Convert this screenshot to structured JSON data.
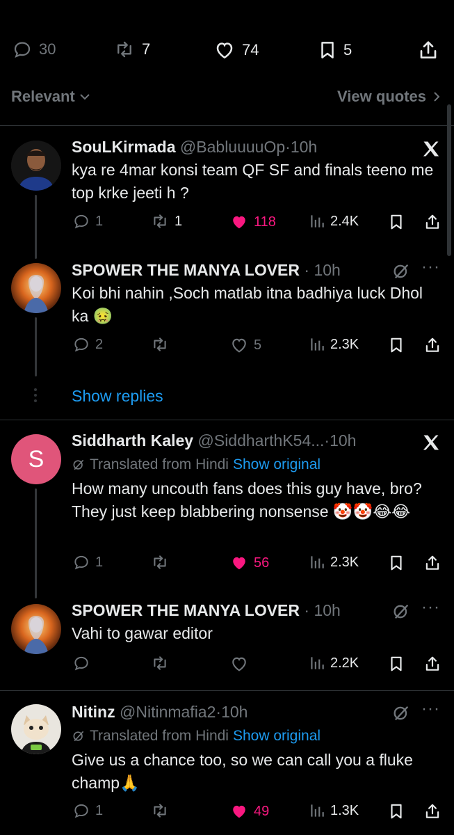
{
  "top_stats": {
    "replies": "30",
    "reposts": "7",
    "likes": "74",
    "bookmarks": "5"
  },
  "filter": {
    "label": "Relevant",
    "view_quotes": "View quotes"
  },
  "replies": [
    {
      "name": "SouLKirmada",
      "handle": "@BabluuuuOp",
      "time": "10h",
      "text": "kya re 4mar konsi team QF SF and finals teeno me top krke jeeti h ?",
      "stats": {
        "replies": "1",
        "reposts": "1",
        "likes": "118",
        "views": "2.4K"
      }
    },
    {
      "name": "SPOWER THE MANYA LOVER",
      "handle": "",
      "time": "10h",
      "text": "Koi bhi nahin ,Soch matlab itna badhiya luck Dhol ka 🤢",
      "stats": {
        "replies": "2",
        "reposts": "",
        "likes": "5",
        "views": "2.3K"
      }
    },
    {
      "name": "Siddharth Kaley",
      "handle": "@SiddharthK54...",
      "time": "10h",
      "avatar_letter": "S",
      "translated": "Translated from Hindi",
      "show_original": "Show original",
      "text": "How many uncouth fans does this guy have, bro? They just keep blabbering nonsense 🤡🤡😂😂",
      "stats": {
        "replies": "1",
        "reposts": "",
        "likes": "56",
        "views": "2.3K"
      }
    },
    {
      "name": "SPOWER THE MANYA LOVER",
      "handle": "",
      "time": "10h",
      "text": "Vahi to gawar editor",
      "stats": {
        "replies": "",
        "reposts": "",
        "likes": "",
        "views": "2.2K"
      }
    },
    {
      "name": "Nitinz",
      "handle": "@Nitinmafia2",
      "time": "10h",
      "translated": "Translated from Hindi",
      "show_original": "Show original",
      "text": "Give us a chance too, so we can call you a fluke champ🙏",
      "stats": {
        "replies": "1",
        "reposts": "",
        "likes": "49",
        "views": "1.3K"
      }
    }
  ],
  "show_replies": "Show replies",
  "colors": {
    "background": "#000000",
    "text": "#e7e9ea",
    "secondary": "#71767b",
    "link": "#1d9bf0",
    "like": "#f91880",
    "divider": "#2f3336",
    "avatar_s": "#e0557a"
  }
}
